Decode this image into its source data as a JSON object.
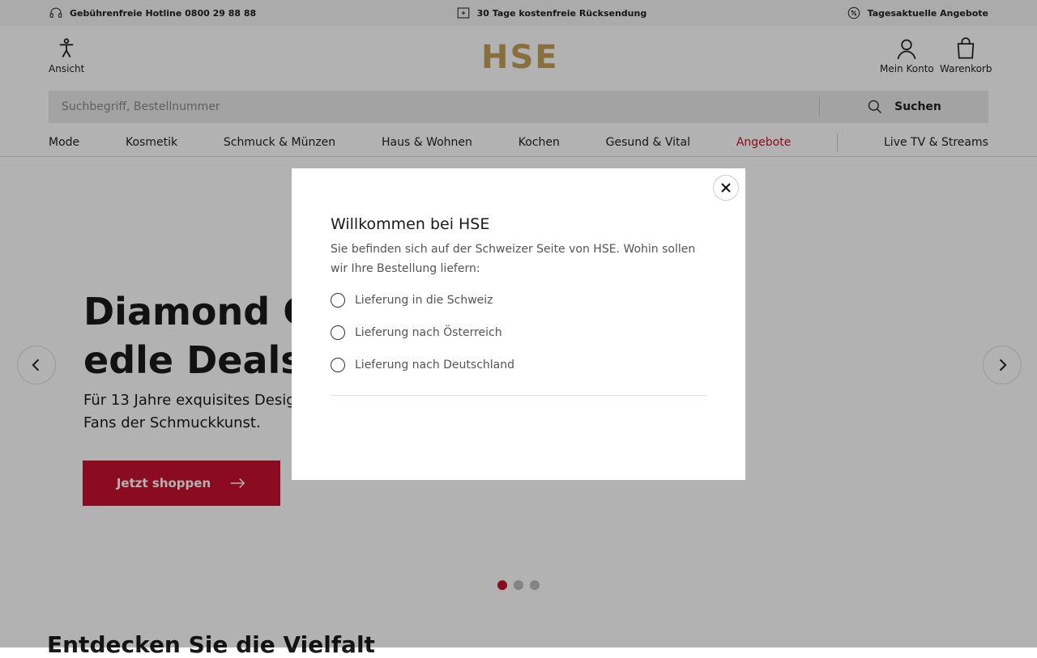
{
  "topbar": {
    "hotline": "Gebührenfreie Hotline 0800 29 88 88",
    "returns": "30 Tage kostenfreie Rücksendung",
    "offers": "Tagesaktuelle Angebote"
  },
  "header": {
    "view_label": "Ansicht",
    "logo": "HSE",
    "account_label": "Mein Konto",
    "cart_label": "Warenkorb"
  },
  "search": {
    "placeholder": "Suchbegriff, Bestellnummer",
    "button_label": "Suchen"
  },
  "nav": {
    "items": [
      "Mode",
      "Kosmetik",
      "Schmuck & Münzen",
      "Haus & Wohnen",
      "Kochen",
      "Gesund & Vital",
      "Angebote",
      "Live TV & Streams"
    ]
  },
  "hero": {
    "title": "Diamond Co… edle Deals",
    "title_line1": "Diamond Co",
    "title_line2": "edle Deals",
    "subtitle_line1": "Für 13 Jahre exquisites Design",
    "subtitle_line2": "Fans der Schmuckkunst.",
    "cta_label": "Jetzt shoppen",
    "slides": 3,
    "active_slide": 1
  },
  "section": {
    "title": "Entdecken Sie die Vielfalt"
  },
  "modal": {
    "title": "Willkommen bei HSE",
    "description": "Sie befinden sich auf der Schweizer Seite von HSE. Wohin sollen wir Ihre Bestellung liefern:",
    "options": [
      "Lieferung in die Schweiz",
      "Lieferung nach Österreich",
      "Lieferung nach Deutschland"
    ]
  },
  "colors": {
    "accent": "#c8102e",
    "logo_gold": "#c3a15a"
  }
}
